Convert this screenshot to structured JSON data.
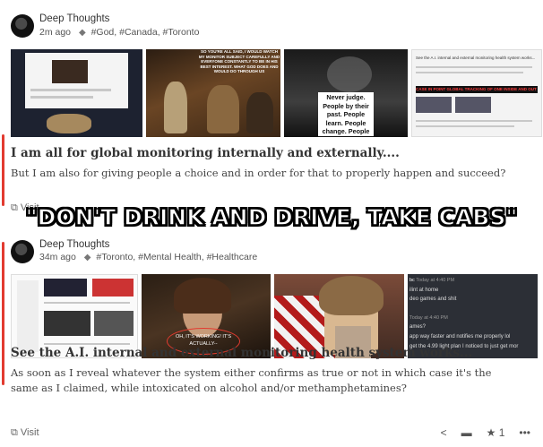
{
  "post1": {
    "author": "Deep Thoughts",
    "time": "2m ago",
    "tags": "#God, #Canada, #Toronto",
    "title": "I am all for global monitoring internally and externally....",
    "body": "But I am also for giving people a choice and in order for that to properly happen and succeed?",
    "visit_label": "Visit",
    "thumb2_caption": "SO YOU'RE ALL SAID, I WOULD WATCH MY MONITOR SUBJECT CAREFULLY AND EVERYONE CONSTANTLY TO BE IN HIS BEST INTEREST. WHAT GOD DOES AND WOULD DO THROUGH US",
    "thumb3_caption": "Never judge. People by their past. People learn. People change. People move on.",
    "thumb4_heading": "See the A.I. internal and external monitoring health system works...",
    "thumb4_banner": "CASE IN POINT GLOBAL TRACKING OF ONE INSIDE AND OUT"
  },
  "meme_text": "\"DON'T DRINK AND DRIVE, TAKE CABS\"",
  "post2": {
    "author": "Deep Thoughts",
    "time": "34m ago",
    "tags": "#Toronto, #Mental Health, #Healthcare",
    "title": "See the A.I. internal and external monitoring health system works...",
    "body": "As soon as I reveal whatever the system either confirms as true or not in which case it's the same as I claimed, while intoxicated on alcohol and/or methamphetamines?",
    "visit_label": "Visit",
    "star_count": "1",
    "thumb2_caption": "OH, IT'S WORKING! IT'S ACTUALLY--",
    "thumb4_chat": [
      "ilint at home",
      "deo games and shit",
      "ames?",
      "app way faster and notifies me properly lol",
      "get the 4.99 light plan I noticed to just get mor"
    ],
    "thumb4_times": [
      "Today at 4:40 PM",
      "Today at 4:40 PM"
    ]
  },
  "colors": {
    "accent_red": "#e23b30",
    "meme_fill": "#ffffff",
    "meme_stroke": "#000000"
  }
}
